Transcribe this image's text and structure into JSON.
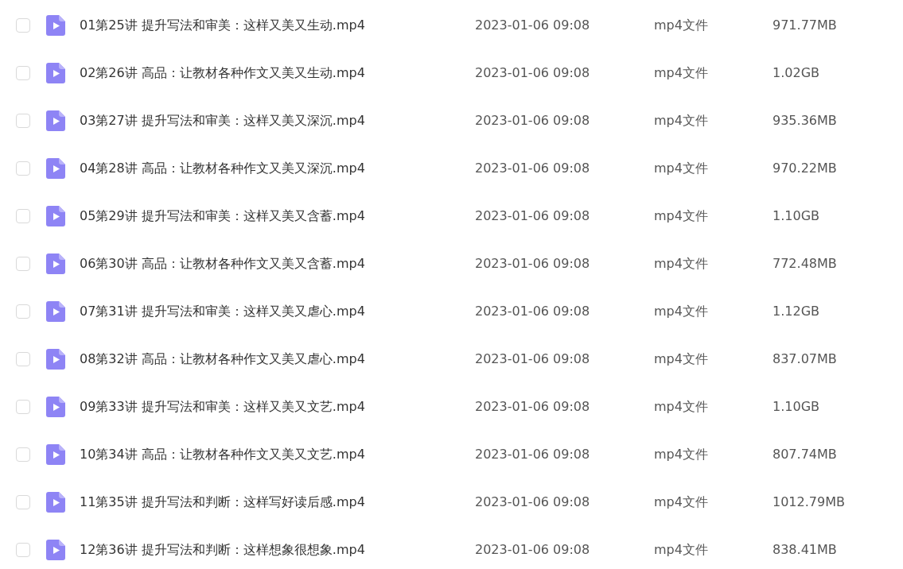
{
  "files": [
    {
      "checked": false,
      "name": "01第25讲 提升写法和审美：这样又美又生动.mp4",
      "date": "2023-01-06 09:08",
      "type": "mp4文件",
      "size": "971.77MB"
    },
    {
      "checked": false,
      "name": "02第26讲 高品：让教材各种作文又美又生动.mp4",
      "date": "2023-01-06 09:08",
      "type": "mp4文件",
      "size": "1.02GB"
    },
    {
      "checked": false,
      "name": "03第27讲 提升写法和审美：这样又美又深沉.mp4",
      "date": "2023-01-06 09:08",
      "type": "mp4文件",
      "size": "935.36MB"
    },
    {
      "checked": false,
      "name": "04第28讲 高品：让教材各种作文又美又深沉.mp4",
      "date": "2023-01-06 09:08",
      "type": "mp4文件",
      "size": "970.22MB"
    },
    {
      "checked": false,
      "name": "05第29讲 提升写法和审美：这样又美又含蓄.mp4",
      "date": "2023-01-06 09:08",
      "type": "mp4文件",
      "size": "1.10GB"
    },
    {
      "checked": false,
      "name": "06第30讲 高品：让教材各种作文又美又含蓄.mp4",
      "date": "2023-01-06 09:08",
      "type": "mp4文件",
      "size": "772.48MB"
    },
    {
      "checked": false,
      "name": "07第31讲 提升写法和审美：这样又美又虐心.mp4",
      "date": "2023-01-06 09:08",
      "type": "mp4文件",
      "size": "1.12GB"
    },
    {
      "checked": false,
      "name": "08第32讲 高品：让教材各种作文又美又虐心.mp4",
      "date": "2023-01-06 09:08",
      "type": "mp4文件",
      "size": "837.07MB"
    },
    {
      "checked": false,
      "name": "09第33讲 提升写法和审美：这样又美又文艺.mp4",
      "date": "2023-01-06 09:08",
      "type": "mp4文件",
      "size": "1.10GB"
    },
    {
      "checked": false,
      "name": "10第34讲 高品：让教材各种作文又美又文艺.mp4",
      "date": "2023-01-06 09:08",
      "type": "mp4文件",
      "size": "807.74MB"
    },
    {
      "checked": false,
      "name": "11第35讲 提升写法和判断：这样写好读后感.mp4",
      "date": "2023-01-06 09:08",
      "type": "mp4文件",
      "size": "1012.79MB"
    },
    {
      "checked": false,
      "name": "12第36讲 提升写法和判断：这样想象很想象.mp4",
      "date": "2023-01-06 09:08",
      "type": "mp4文件",
      "size": "838.41MB"
    }
  ]
}
